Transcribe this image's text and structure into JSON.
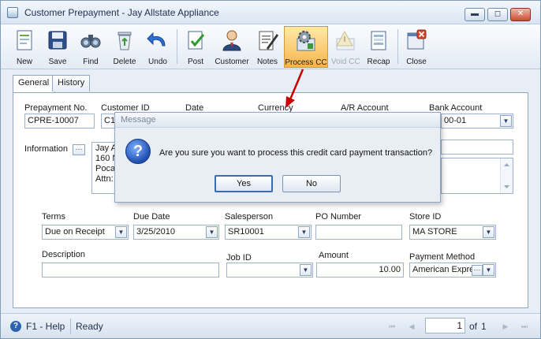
{
  "window": {
    "title": "Customer Prepayment - Jay Allstate Appliance",
    "minimize": "▬",
    "maximize": "◻",
    "close": "✕"
  },
  "toolbar": {
    "new": "New",
    "save": "Save",
    "find": "Find",
    "delete": "Delete",
    "undo": "Undo",
    "post": "Post",
    "customer": "Customer",
    "notes": "Notes",
    "process_cc": "Process CC",
    "void_cc": "Void CC",
    "recap": "Recap",
    "close": "Close"
  },
  "tabs": {
    "general": "General",
    "history": "History"
  },
  "form": {
    "prepayment_no_label": "Prepayment No.",
    "prepayment_no": "CPRE-10007",
    "customer_id_label": "Customer ID",
    "customer_id": "C1",
    "date_label": "Date",
    "currency_label": "Currency",
    "ar_account_label": "A/R Account",
    "bank_account_label": "Bank Account",
    "bank_account": "00-01",
    "information_label": "Information",
    "information_button": "···",
    "address_lines": [
      "Jay A",
      "160 N",
      "Poca",
      "Attn:"
    ],
    "terms_label": "Terms",
    "terms": "Due on Receipt",
    "due_date_label": "Due Date",
    "due_date": "3/25/2010",
    "salesperson_label": "Salesperson",
    "salesperson": "SR10001",
    "po_number_label": "PO Number",
    "po_number": "",
    "store_id_label": "Store ID",
    "store_id": "MA STORE",
    "description_label": "Description",
    "description": "",
    "job_id_label": "Job ID",
    "job_id": "",
    "amount_label": "Amount",
    "amount": "10.00",
    "payment_method_label": "Payment Method",
    "payment_method": "American Expre",
    "payment_method_button": "···",
    "dropdown_glyph": "▼"
  },
  "dialog": {
    "title": "Message",
    "icon": "?",
    "message": "Are you sure you want to process this credit card payment transaction?",
    "yes": "Yes",
    "no": "No"
  },
  "status": {
    "help_icon": "?",
    "help": "F1 - Help",
    "state": "Ready",
    "page": "1",
    "of_label": "of",
    "total_pages": "1",
    "nav_first": "⏮",
    "nav_prev": "◀",
    "nav_next": "▶",
    "nav_last": "⏭"
  },
  "colors": {
    "accent": "#f7b64c",
    "annotation_arrow": "#c80000"
  },
  "icons": {
    "new": "new-document-icon",
    "save": "floppy-disk-icon",
    "find": "binoculars-icon",
    "delete": "recycle-bin-icon",
    "undo": "undo-arrow-icon",
    "post": "post-document-icon",
    "customer": "customer-person-icon",
    "notes": "notes-pen-icon",
    "process_cc": "process-gear-icon",
    "void_cc": "void-warning-icon",
    "recap": "recap-report-icon",
    "close": "close-window-icon",
    "dialog": "question-icon"
  }
}
